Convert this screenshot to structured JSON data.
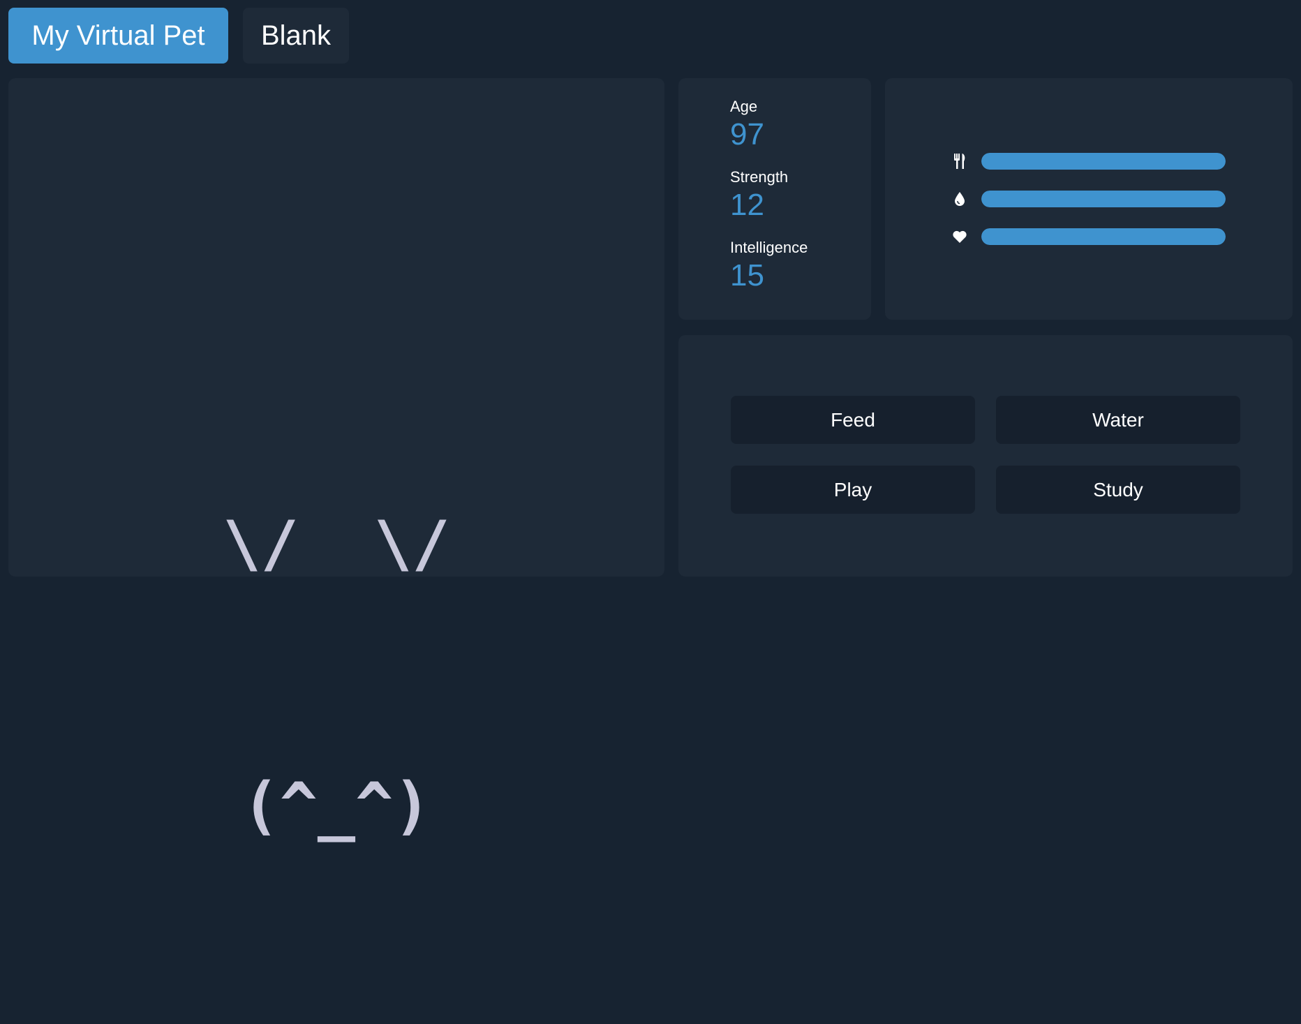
{
  "tabs": [
    {
      "label": "My Virtual Pet",
      "active": true
    },
    {
      "label": "Blank",
      "active": false
    }
  ],
  "pet": {
    "face_line_1": "\\/  \\/",
    "face_line_2": "(^_^)"
  },
  "stats": [
    {
      "label": "Age",
      "value": "97"
    },
    {
      "label": "Strength",
      "value": "12"
    },
    {
      "label": "Intelligence",
      "value": "15"
    }
  ],
  "meters": [
    {
      "icon": "fork-knife-icon",
      "name": "hunger",
      "level": 1.0
    },
    {
      "icon": "water-drop-icon",
      "name": "thirst",
      "level": 1.0
    },
    {
      "icon": "heart-icon",
      "name": "happiness",
      "level": 1.0
    }
  ],
  "actions": {
    "feed": "Feed",
    "water": "Water",
    "play": "Play",
    "study": "Study"
  },
  "colors": {
    "background": "#172331",
    "panel": "#1e2a38",
    "accent": "#3f93cf",
    "button": "#16202d",
    "pet_text": "#c7c7da"
  }
}
